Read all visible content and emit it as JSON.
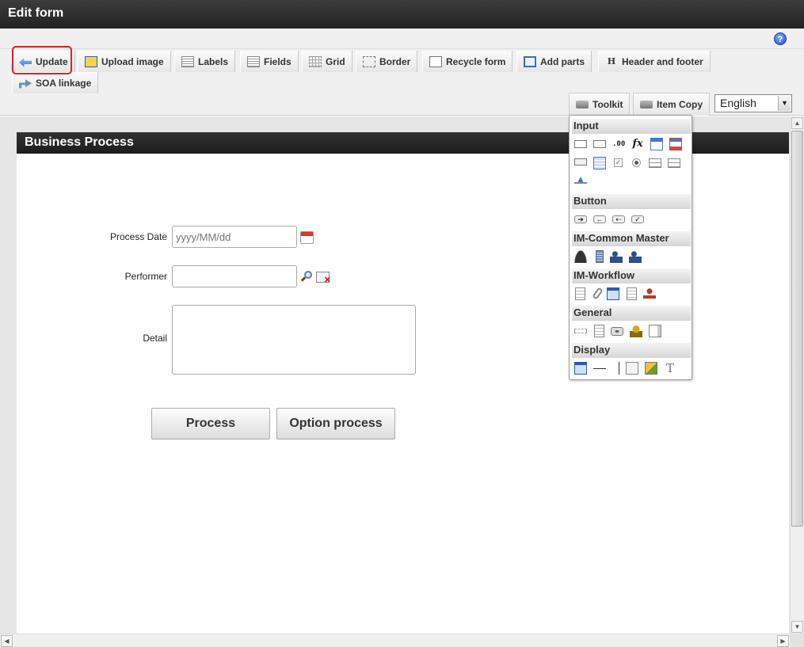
{
  "window": {
    "title": "Edit form"
  },
  "toolbar": {
    "update_label": "Update",
    "upload_image_label": "Upload image",
    "labels_label": "Labels",
    "fields_label": "Fields",
    "grid_label": "Grid",
    "border_label": "Border",
    "recycle_form_label": "Recycle form",
    "add_parts_label": "Add parts",
    "header_footer_label": "Header and footer",
    "soa_linkage_label": "SOA linkage",
    "toolkit_label": "Toolkit",
    "item_copy_label": "Item Copy",
    "language": "English"
  },
  "form": {
    "title": "Business Process",
    "process_date_label": "Process Date",
    "process_date_placeholder": "yyyy/MM/dd",
    "performer_label": "Performer",
    "detail_label": "Detail",
    "process_button": "Process",
    "option_process_button": "Option process"
  },
  "toolkit": {
    "sections": {
      "input": "Input",
      "button": "Button",
      "common_master": "IM-Common Master",
      "workflow": "IM-Workflow",
      "general": "General",
      "display": "Display"
    }
  },
  "colors": {
    "highlight": "#dd2222",
    "header_bg": "#222222"
  }
}
